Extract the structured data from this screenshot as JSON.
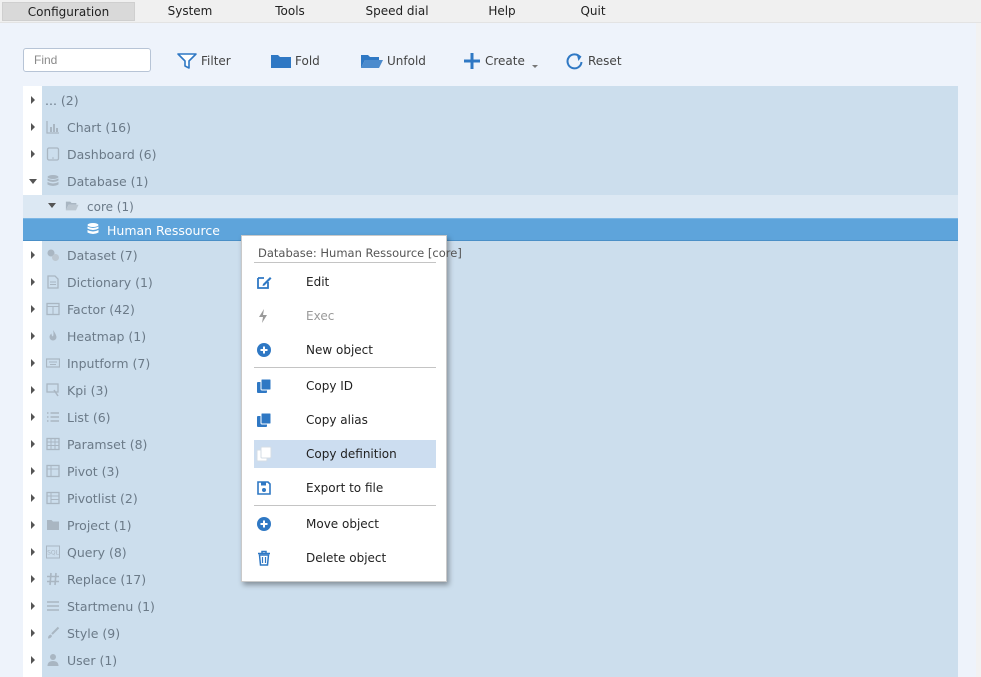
{
  "menu": [
    "Configuration",
    "System",
    "Tools",
    "Speed dial",
    "Help",
    "Quit"
  ],
  "toolbar": {
    "find_placeholder": "Find",
    "filter": "Filter",
    "fold": "Fold",
    "unfold": "Unfold",
    "create": "Create",
    "reset": "Reset"
  },
  "tree": {
    "root": "... (2)",
    "chart": "Chart (16)",
    "dashboard": "Dashboard (6)",
    "database": "Database (1)",
    "core": "core (1)",
    "human": "Human Ressource",
    "dataset": "Dataset (7)",
    "dictionary": "Dictionary (1)",
    "factor": "Factor (42)",
    "heatmap": "Heatmap (1)",
    "inputform": "Inputform (7)",
    "kpi": "Kpi (3)",
    "list": "List (6)",
    "paramset": "Paramset (8)",
    "pivot": "Pivot (3)",
    "pivotlist": "Pivotlist (2)",
    "project": "Project (1)",
    "query": "Query (8)",
    "replace": "Replace (17)",
    "startmenu": "Startmenu (1)",
    "style": "Style (9)",
    "user": "User (1)"
  },
  "context_menu": {
    "title": "Database: Human Ressource [core]",
    "edit": "Edit",
    "exec": "Exec",
    "new_object": "New object",
    "copy_id": "Copy ID",
    "copy_alias": "Copy alias",
    "copy_definition": "Copy definition",
    "export_to_file": "Export to file",
    "move_object": "Move object",
    "delete_object": "Delete object"
  },
  "colors": {
    "accent": "#2f78c4",
    "tree_bg": "#ccdeed",
    "selected_row": "#5ea4db",
    "highlight": "#ccddf0"
  }
}
